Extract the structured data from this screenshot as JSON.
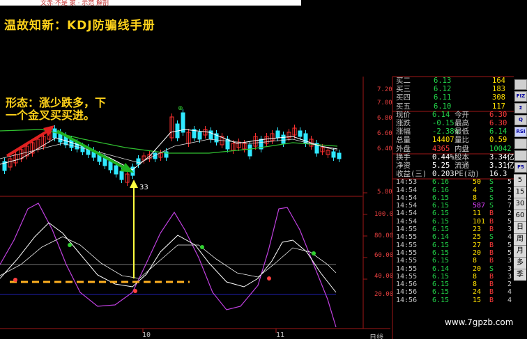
{
  "header": {
    "title": "温故知新：KDJ防骗线手册",
    "top_band_text": "文赤·不是 家 · 示范 解剖"
  },
  "annotation": "形态：涨少跌多，下\n一个金叉买买进。",
  "watermark": "www.7gpzb.com",
  "price_axis": [
    "7.20",
    "7.00",
    "6.80",
    "6.60",
    "6.40",
    "5.80"
  ],
  "kdj_axis": [
    "100.0",
    "80.00",
    "60.00",
    "40.00",
    "20.00"
  ],
  "volume_marker": "33",
  "x_labels": [
    "10",
    "11",
    "日线"
  ],
  "quote": {
    "asks": [
      {
        "label": "买二",
        "price": "6.13",
        "vol": "164"
      },
      {
        "label": "买三",
        "price": "6.12",
        "vol": "183"
      },
      {
        "label": "买四",
        "price": "6.11",
        "vol": "308"
      },
      {
        "label": "买五",
        "price": "6.10",
        "vol": "117"
      }
    ],
    "stats": [
      {
        "l1": "现价",
        "v1": "6.14",
        "l2": "今开",
        "v2": "6.30",
        "c1": "green",
        "c2": "red"
      },
      {
        "l1": "涨跌",
        "v1": "-0.15",
        "l2": "最高",
        "v2": "6.30",
        "c1": "green",
        "c2": "red"
      },
      {
        "l1": "涨幅",
        "v1": "-2.38%",
        "l2": "最低",
        "v2": "6.14",
        "c1": "green",
        "c2": "green"
      },
      {
        "l1": "总量",
        "v1": "14407",
        "l2": "量比",
        "v2": "0.59",
        "c1": "yellow",
        "c2": "yellow"
      },
      {
        "l1": "外盘",
        "v1": "4365",
        "l2": "内盘",
        "v2": "10042",
        "c1": "red",
        "c2": "green"
      },
      {
        "l1": "换手",
        "v1": "0.44%",
        "l2": "股本",
        "v2": "3.34亿",
        "c1": "white",
        "c2": "white"
      },
      {
        "l1": "净资",
        "v1": "5.25",
        "l2": "流通",
        "v2": "3.31亿",
        "c1": "white",
        "c2": "white"
      },
      {
        "l1": "收益(三)",
        "v1": "0.203",
        "l2": "PE(动)",
        "v2": "16.3",
        "c1": "white",
        "c2": "white"
      }
    ],
    "ticks": [
      {
        "time": "14:53",
        "price": "6.16",
        "vol": "50",
        "side": "S",
        "n": "5"
      },
      {
        "time": "14:54",
        "price": "6.16",
        "vol": "4",
        "side": "S",
        "n": "2"
      },
      {
        "time": "14:54",
        "price": "6.15",
        "vol": "8",
        "side": "S",
        "n": "2"
      },
      {
        "time": "14:54",
        "price": "6.15",
        "vol": "587",
        "side": "S",
        "n": "7"
      },
      {
        "time": "14:54",
        "price": "6.15",
        "vol": "11",
        "side": "B",
        "n": "2"
      },
      {
        "time": "14:54",
        "price": "6.15",
        "vol": "101",
        "side": "B",
        "n": "5"
      },
      {
        "time": "14:55",
        "price": "6.15",
        "vol": "23",
        "side": "B",
        "n": "3"
      },
      {
        "time": "14:55",
        "price": "6.14",
        "vol": "25",
        "side": "S",
        "n": "4"
      },
      {
        "time": "14:55",
        "price": "6.15",
        "vol": "27",
        "side": "B",
        "n": "5"
      },
      {
        "time": "14:55",
        "price": "6.15",
        "vol": "20",
        "side": "B",
        "n": "5"
      },
      {
        "time": "14:55",
        "price": "6.15",
        "vol": "8",
        "side": "B",
        "n": "3"
      },
      {
        "time": "14:55",
        "price": "6.14",
        "vol": "20",
        "side": "S",
        "n": "3"
      },
      {
        "time": "14:55",
        "price": "6.15",
        "vol": "8",
        "side": "B",
        "n": "3"
      },
      {
        "time": "14:56",
        "price": "6.15",
        "vol": "8",
        "side": "B",
        "n": "2"
      },
      {
        "time": "14:56",
        "price": "6.15",
        "vol": "24",
        "side": "B",
        "n": "4"
      },
      {
        "time": "14:56",
        "price": "6.15",
        "vol": "15",
        "side": "B",
        "n": "4"
      }
    ]
  },
  "toolbar": {
    "buttons": [
      "",
      "FIZ",
      "Σ",
      "Q",
      "RSI",
      "",
      "",
      "F5"
    ],
    "periods": [
      "5",
      "15",
      "30",
      "60",
      "日",
      "周",
      "月",
      "多",
      "季"
    ]
  },
  "colors": {
    "up": "#ff3030",
    "down": "#30e8ff",
    "k": "#ffffff",
    "d": "#ffffff",
    "j": "#c040e0",
    "ma": "#30c030",
    "annotation": "#ffd21a"
  }
}
